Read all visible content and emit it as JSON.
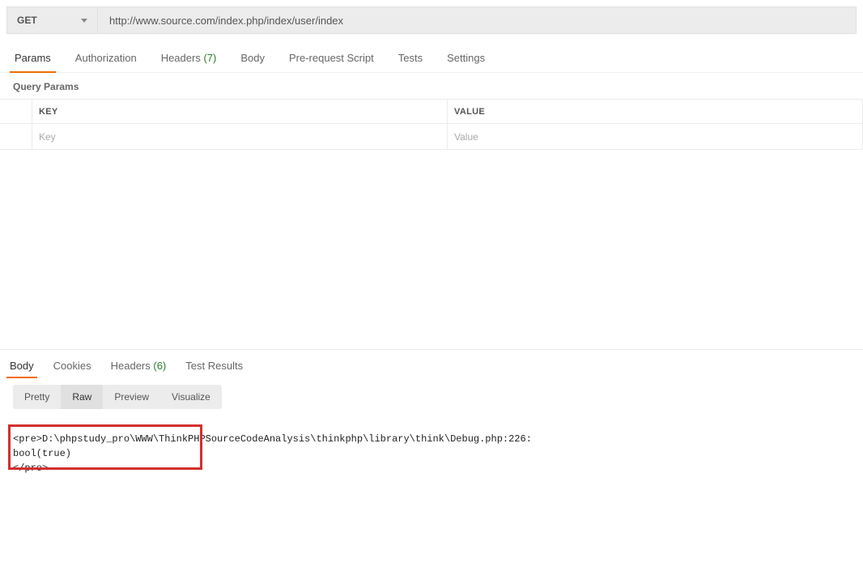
{
  "request": {
    "method": "GET",
    "url": "http://www.source.com/index.php/index/user/index"
  },
  "reqTabs": {
    "params": "Params",
    "authorization": "Authorization",
    "headers": "Headers",
    "headersCount": "(7)",
    "body": "Body",
    "prerequest": "Pre-request Script",
    "tests": "Tests",
    "settings": "Settings"
  },
  "querySection": {
    "title": "Query Params",
    "keyHeader": "KEY",
    "valueHeader": "VALUE",
    "keyPlaceholder": "Key",
    "valuePlaceholder": "Value"
  },
  "respTabs": {
    "body": "Body",
    "cookies": "Cookies",
    "headers": "Headers",
    "headersCount": "(6)",
    "testResults": "Test Results"
  },
  "viewTabs": {
    "pretty": "Pretty",
    "raw": "Raw",
    "preview": "Preview",
    "visualize": "Visualize"
  },
  "responseBody": {
    "line1": "<pre>D:\\phpstudy_pro\\WWW\\ThinkPHPSourceCodeAnalysis\\thinkphp\\library\\think\\Debug.php:226:",
    "line2": "bool(true)",
    "line3": "</pre>"
  }
}
